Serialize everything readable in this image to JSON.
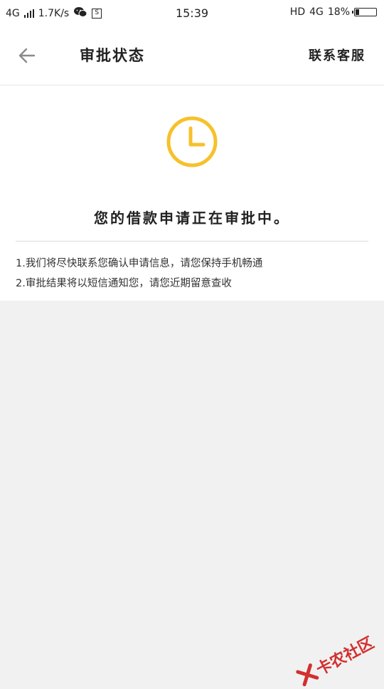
{
  "status_bar": {
    "network_left": "4G",
    "speed": "1.7K/s",
    "wechat_icon": "wechat-icon",
    "sim_badge": "S",
    "time": "15:39",
    "hd": "HD",
    "network_right": "4G",
    "battery_percent": "18%",
    "battery_level": 0.18
  },
  "app_bar": {
    "title": "审批状态",
    "back_icon": "arrow-left-icon",
    "service_label": "联系客服"
  },
  "content": {
    "status_icon": "clock-icon",
    "accent_color": "#F7C12B",
    "status_message": "您的借款申请正在审批中。",
    "notes": [
      "1.我们将尽快联系您确认申请信息，请您保持手机畅通",
      "2.审批结果将以短信通知您，请您近期留意查收"
    ]
  },
  "watermark": {
    "text": "卡农社区",
    "color": "#D32F2F"
  }
}
